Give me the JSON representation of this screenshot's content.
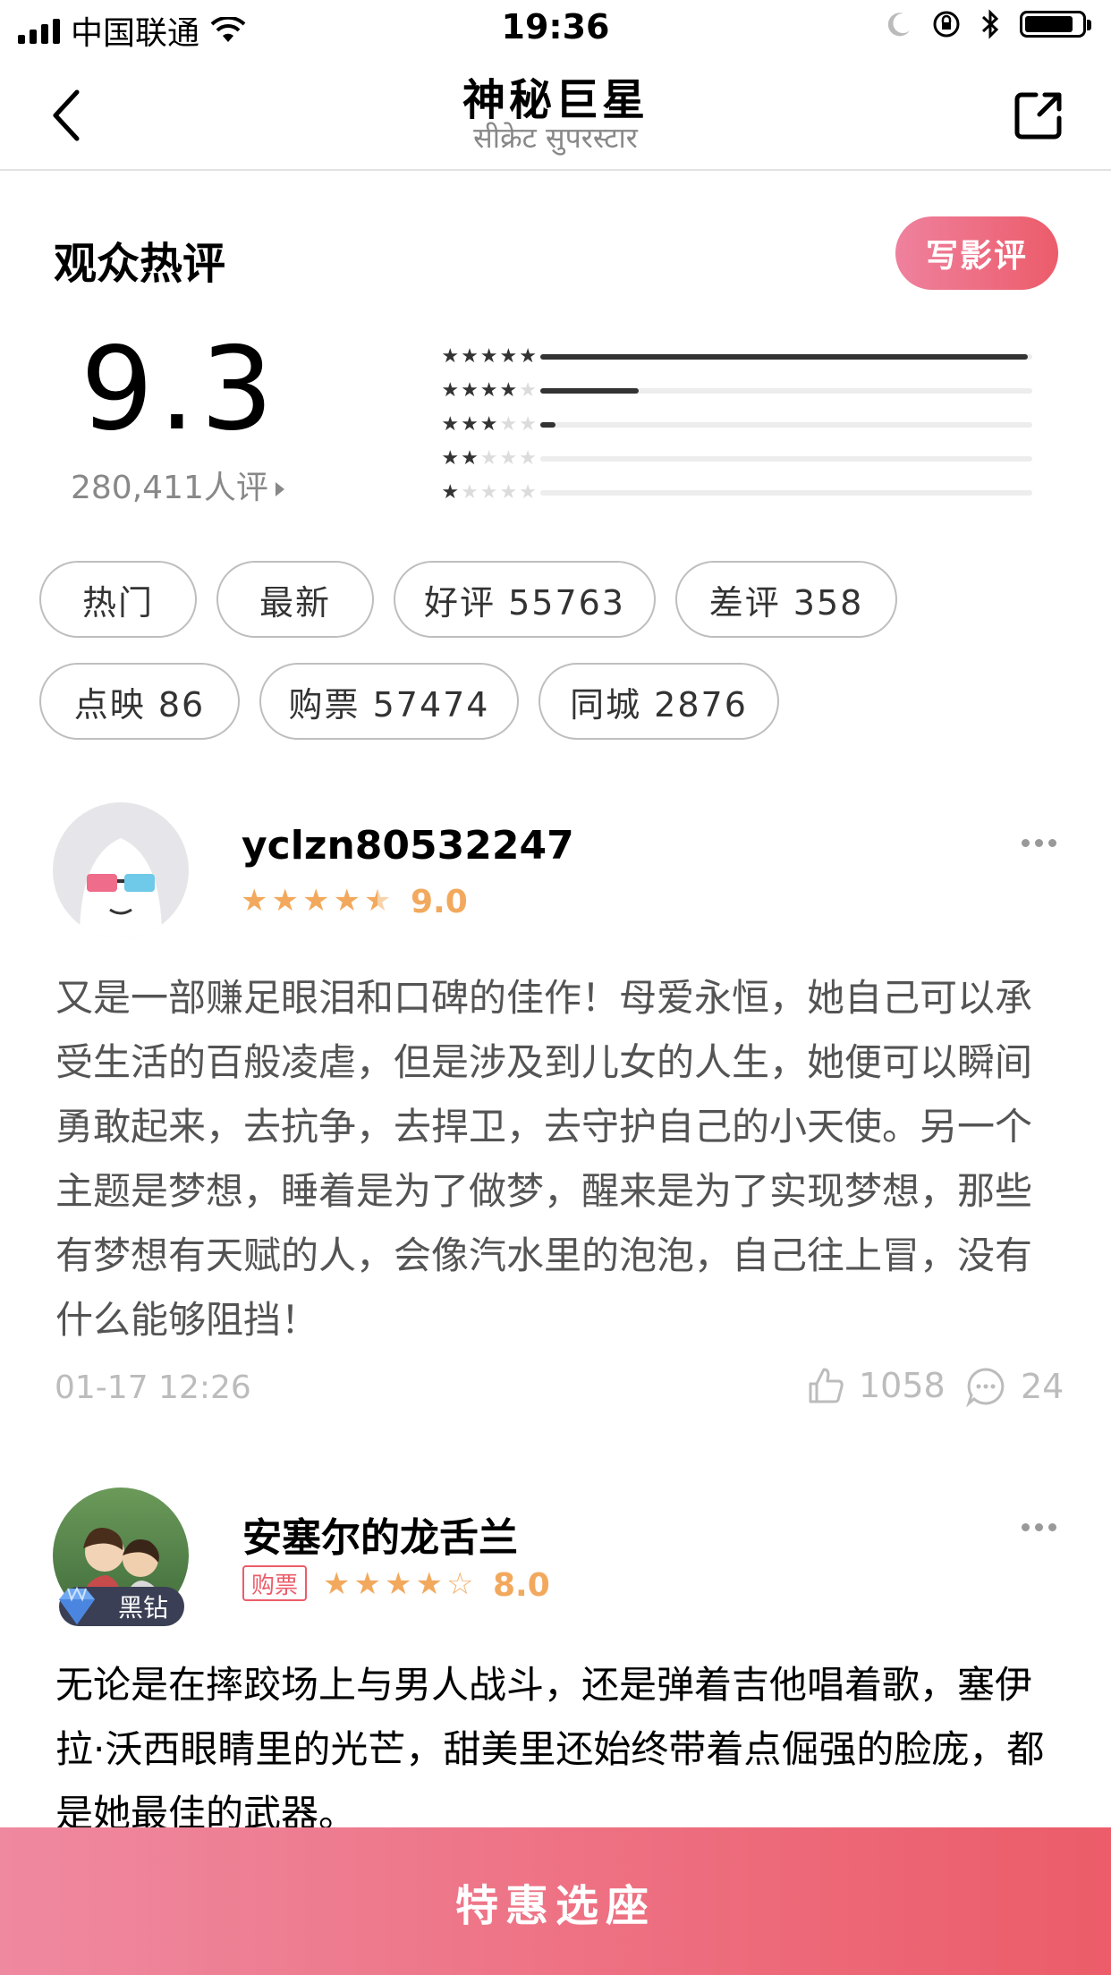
{
  "status_bar": {
    "carrier": "中国联通",
    "time": "19:36",
    "battery_level": 0.85
  },
  "nav": {
    "title": "神秘巨星",
    "subtitle": "सीक्रेट सुपरस्टार"
  },
  "header": {
    "section_title": "观众热评",
    "write_review_label": "写影评"
  },
  "rating": {
    "score": "9.3",
    "count_text": "280,411人评",
    "distribution": [
      {
        "stars": 5,
        "fraction": 0.99
      },
      {
        "stars": 4,
        "fraction": 0.2
      },
      {
        "stars": 3,
        "fraction": 0.03
      },
      {
        "stars": 2,
        "fraction": 0.0
      },
      {
        "stars": 1,
        "fraction": 0.0
      }
    ]
  },
  "filters": {
    "hot": "热门",
    "latest": "最新",
    "positive": "好评 55763",
    "negative": "差评 358",
    "premiere": "点映 86",
    "purchased": "购票 57474",
    "local": "同城 2876"
  },
  "reviews": [
    {
      "username": "yclzn80532247",
      "stars": 4.5,
      "score": "9.0",
      "text": "又是一部赚足眼泪和口碑的佳作！母爱永恒，她自己可以承受生活的百般凌虐，但是涉及到儿女的人生，她便可以瞬间勇敢起来，去抗争，去捍卫，去守护自己的小天使。另一个主题是梦想，睡着是为了做梦，醒来是为了实现梦想，那些有梦想有天赋的人，会像汽水里的泡泡，自己往上冒，没有什么能够阻挡！",
      "date": "01-17 12:26",
      "likes": "1058",
      "comments": "24"
    },
    {
      "username": "安塞尔的龙舌兰",
      "badge": "黑钻",
      "tag": "购票",
      "stars": 4,
      "score": "8.0",
      "text": "无论是在摔跤场上与男人战斗，还是弹着吉他唱着歌，塞伊拉·沃西眼睛里的光芒，甜美里还始终带着点倔强的脸庞，都是她最佳的武器。"
    }
  ],
  "bottom": {
    "cta_label": "特惠选座"
  },
  "colors": {
    "accent_start": "#ef819e",
    "accent_end": "#ec5c6a",
    "star": "#f2a95d",
    "bar": "#333333",
    "bar_bg": "#ededed",
    "text_body": "#545454",
    "meta": "#bcbcbc"
  }
}
